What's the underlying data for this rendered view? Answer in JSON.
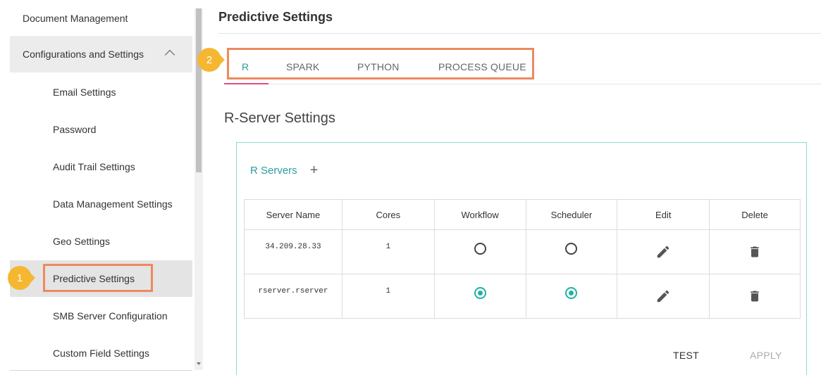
{
  "sidebar": {
    "items": [
      {
        "label": "Document Management"
      },
      {
        "label": "Configurations and Settings"
      },
      {
        "label": "Email Settings"
      },
      {
        "label": "Password"
      },
      {
        "label": "Audit Trail Settings"
      },
      {
        "label": "Data Management Settings"
      },
      {
        "label": "Geo Settings"
      },
      {
        "label": "Predictive Settings"
      },
      {
        "label": "SMB Server Configuration"
      },
      {
        "label": "Custom Field Settings"
      }
    ]
  },
  "callouts": {
    "one": "1",
    "two": "2"
  },
  "main": {
    "title": "Predictive Settings",
    "tabs": [
      {
        "label": "R"
      },
      {
        "label": "SPARK"
      },
      {
        "label": "PYTHON"
      },
      {
        "label": "PROCESS QUEUE"
      }
    ],
    "section_title": "R-Server Settings",
    "servers_label": "R Servers",
    "add_symbol": "+",
    "table": {
      "headers": [
        "Server Name",
        "Cores",
        "Workflow",
        "Scheduler",
        "Edit",
        "Delete"
      ],
      "rows": [
        {
          "server_name": "34.209.28.33",
          "cores": "1",
          "workflow": false,
          "scheduler": false
        },
        {
          "server_name": "rserver.rserver",
          "cores": "1",
          "workflow": true,
          "scheduler": true
        }
      ]
    },
    "buttons": {
      "test": "TEST",
      "apply": "APPLY"
    }
  },
  "colors": {
    "accent": "#2a9d9f",
    "tab_underline": "#e84b7a",
    "callout_border": "#ec8a5e",
    "badge": "#f5b731",
    "radio_on": "#20b2a5"
  }
}
